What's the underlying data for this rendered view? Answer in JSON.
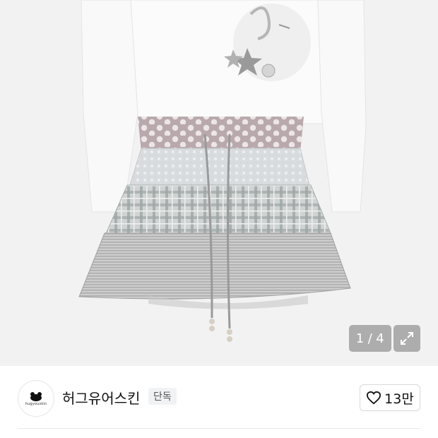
{
  "gallery": {
    "current": "1",
    "separator": "/",
    "total": "4",
    "image_alt": "skirt product photo"
  },
  "brand": {
    "logo_text": "hugyouskin",
    "name": "허그유어스킨",
    "badge": "단독"
  },
  "like": {
    "count": "13만"
  },
  "colors": {
    "accent_gray": "#888888",
    "badge_bg": "#f1f2f4"
  }
}
